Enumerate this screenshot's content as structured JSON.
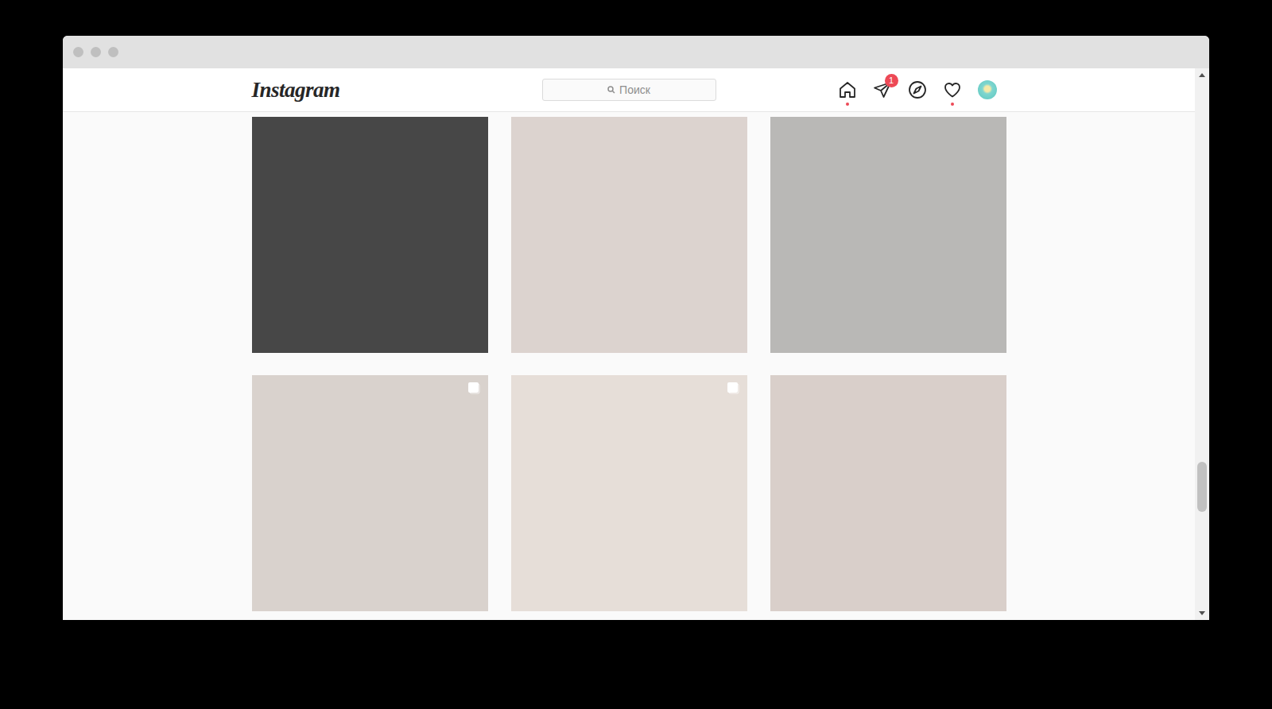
{
  "header": {
    "logo": "Instagram",
    "search": {
      "placeholder": "Поиск"
    }
  },
  "nav": [
    {
      "kind": "home",
      "active": true,
      "dot": true,
      "badge": ""
    },
    {
      "kind": "direct",
      "active": false,
      "dot": false,
      "badge": "1"
    },
    {
      "kind": "explore",
      "active": false,
      "dot": false,
      "badge": ""
    },
    {
      "kind": "activity",
      "active": false,
      "dot": true,
      "badge": ""
    },
    {
      "kind": "profile",
      "active": false,
      "dot": false,
      "badge": ""
    }
  ],
  "posts": [
    {
      "color": "#474747",
      "multiple": false
    },
    {
      "color": "#dcd3cf",
      "multiple": false
    },
    {
      "color": "#b9b8b6",
      "multiple": false
    },
    {
      "color": "#d9d2cd",
      "multiple": true
    },
    {
      "color": "#e6ded8",
      "multiple": true
    },
    {
      "color": "#d9cfca",
      "multiple": false
    }
  ],
  "scrollbar": {
    "level": 0.8
  }
}
